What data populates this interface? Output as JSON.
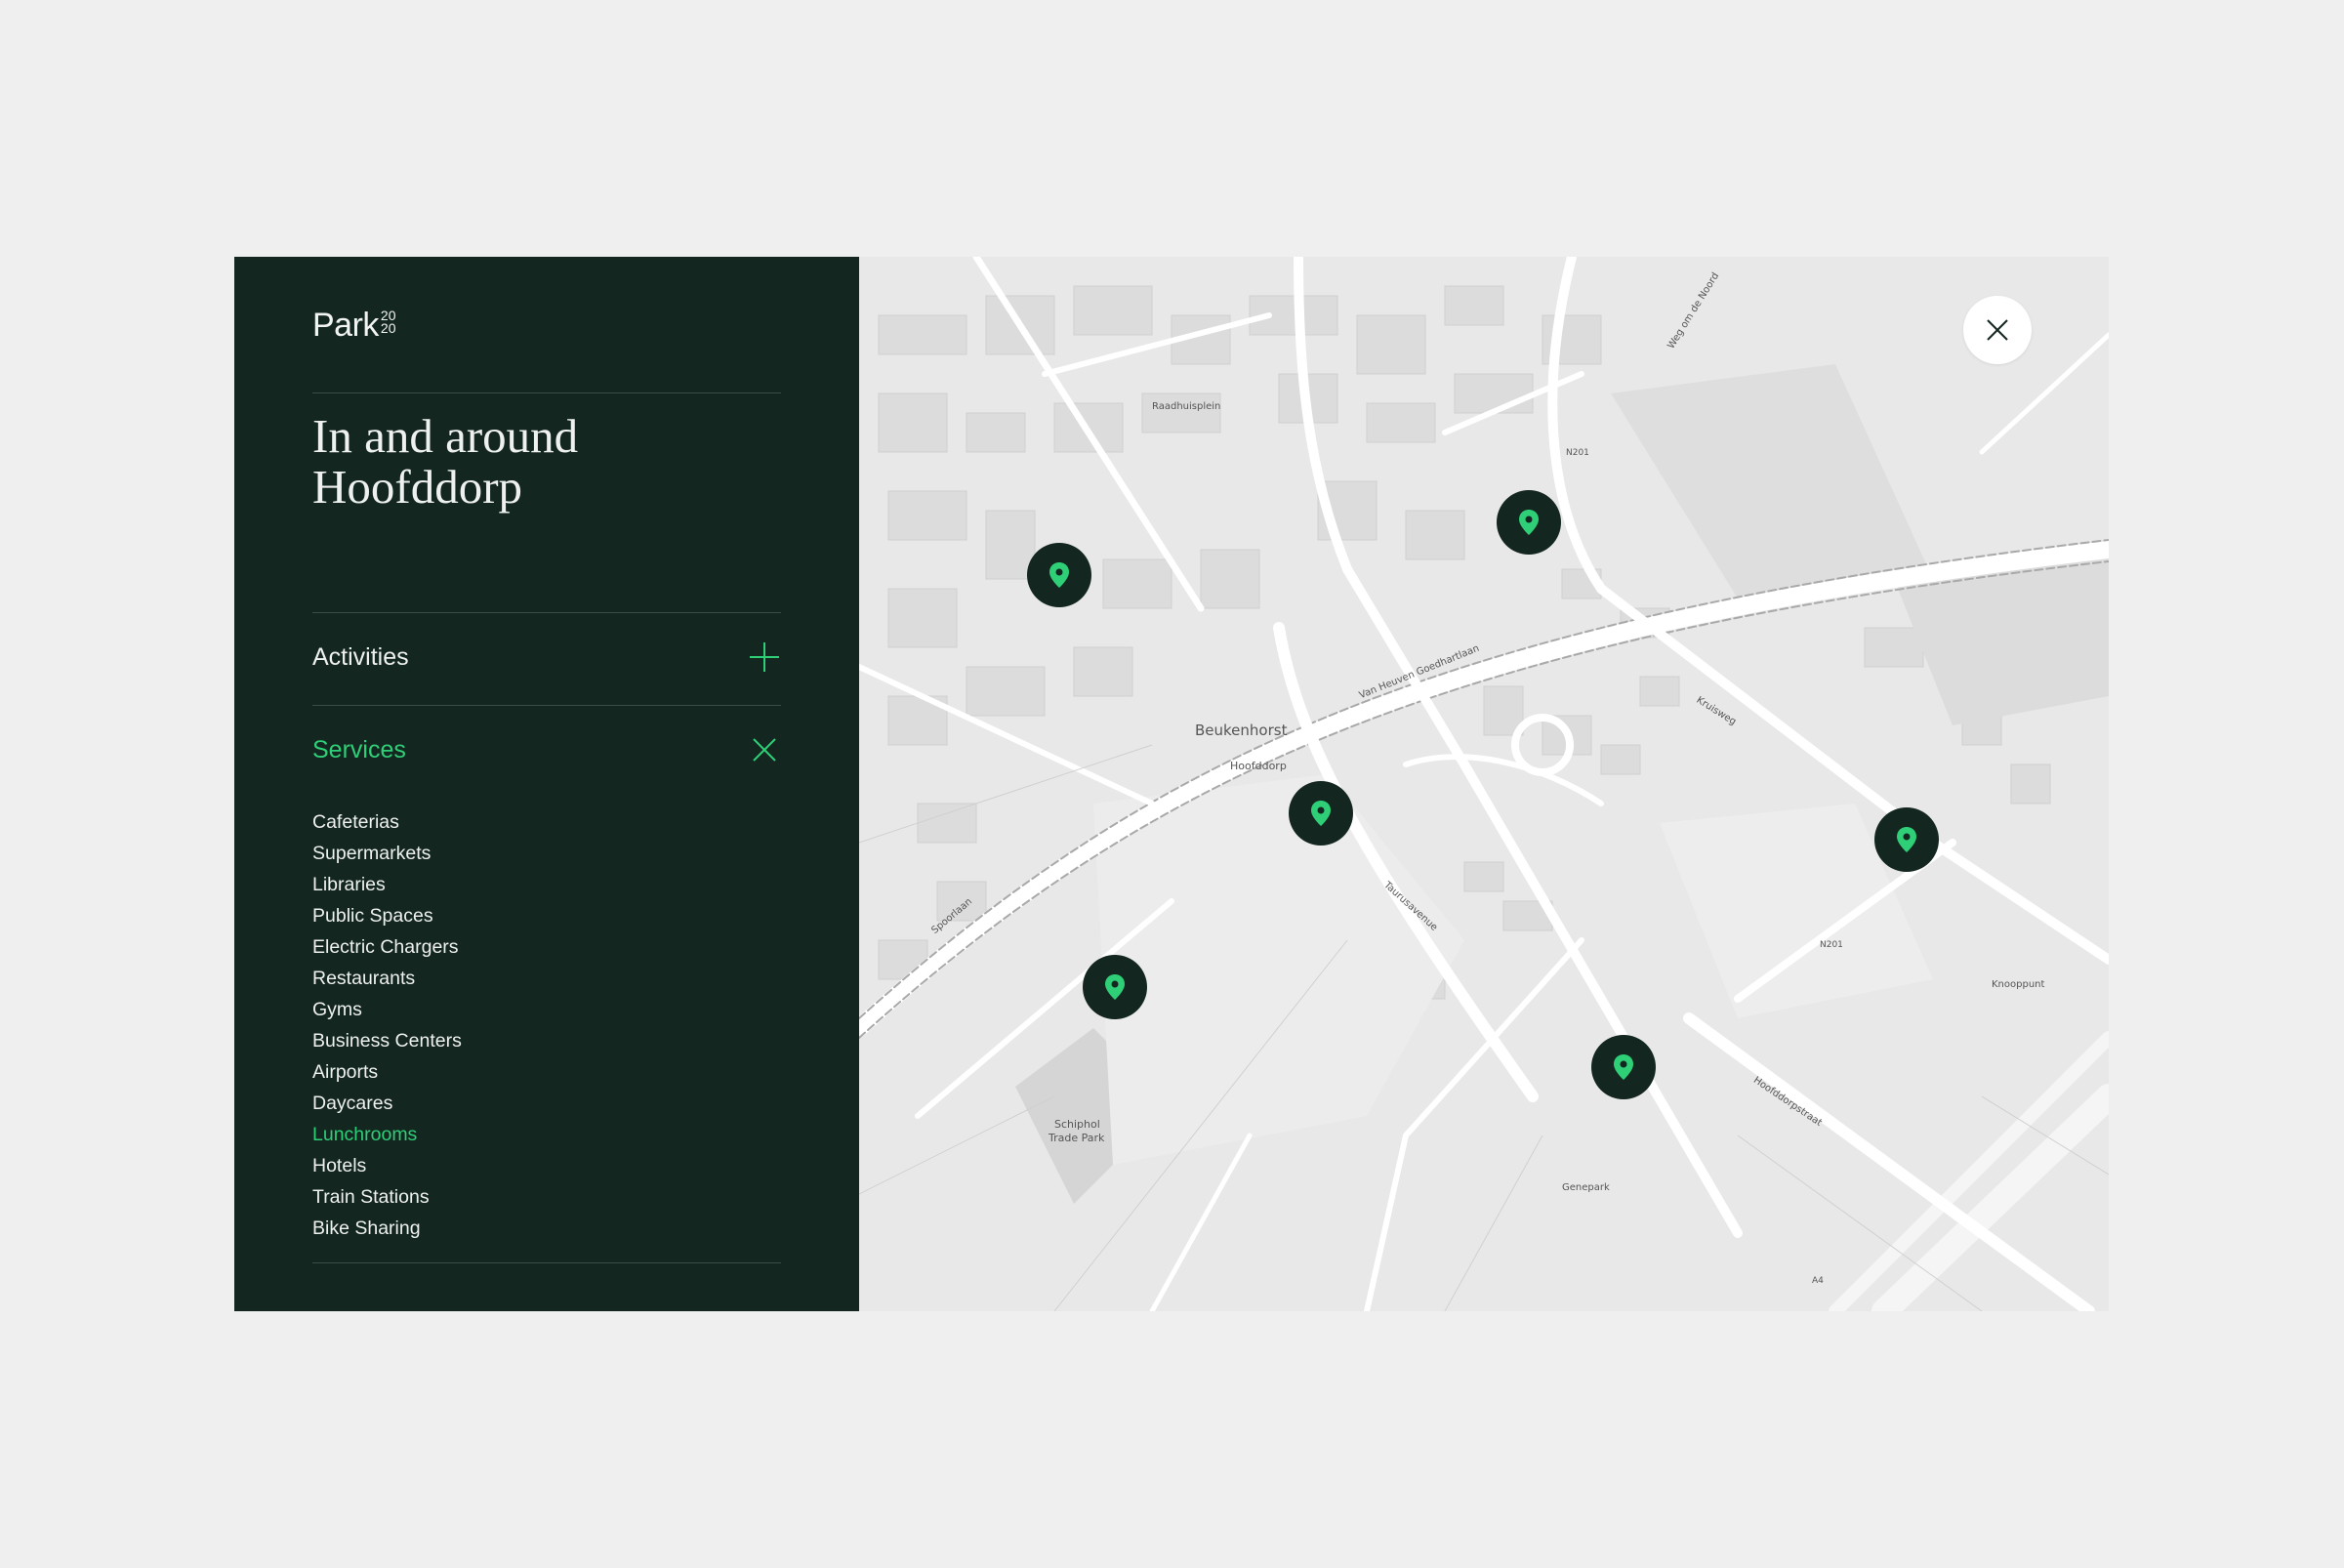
{
  "brand": {
    "name": "Park",
    "sup_top": "20",
    "sup_bottom": "20"
  },
  "title": {
    "line1": "In and around",
    "line2": "Hoofddorp"
  },
  "accordion": [
    {
      "label": "Activities",
      "state": "collapsed",
      "icon": "plus-icon"
    },
    {
      "label": "Services",
      "state": "expanded",
      "icon": "close-icon"
    }
  ],
  "services": [
    "Cafeterias",
    "Supermarkets",
    "Libraries",
    "Public Spaces",
    "Electric Chargers",
    "Restaurants",
    "Gyms",
    "Business Centers",
    "Airports",
    "Daycares",
    "Lunchrooms",
    "Hotels",
    "Train Stations",
    "Bike Sharing"
  ],
  "active_service": "Lunchrooms",
  "map": {
    "labels": {
      "beukenhorst": "Beukenhorst",
      "hoofddorp": "Hoofddorp",
      "schiphol": "Schiphol",
      "trade_park": "Trade Park",
      "raadhuisplein": "Raadhuisplein",
      "n201_a": "N201",
      "n201_b": "N201",
      "a4": "A4",
      "van_heuven": "Van Heuven Goedhartlaan",
      "kruisweg": "Kruisweg",
      "hoofddorpstraat": "Hoofddorpstraat",
      "spoorlaan": "Spoorlaan",
      "weg_om_de_noord": "Weg om de Noord",
      "taurusavenue": "Taurusavenue",
      "knooppunt": "Knooppunt",
      "genepark": "Genepark"
    },
    "marker_count": 6,
    "marker_icon": "map-pin-icon",
    "close_icon": "close-icon"
  },
  "colors": {
    "panel": "#132620",
    "accent": "#2ecf77",
    "background": "#efefef",
    "text": "#eef1ef"
  }
}
